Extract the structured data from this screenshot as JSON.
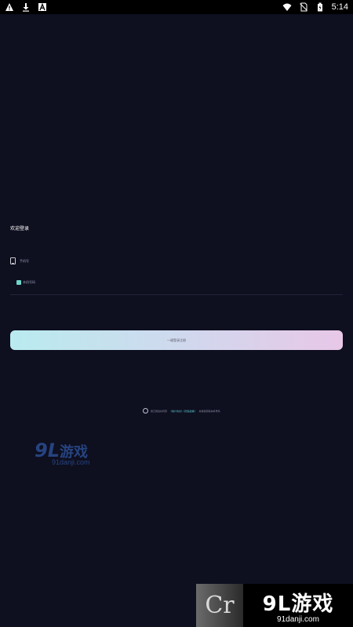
{
  "status_bar": {
    "icons_left": [
      "warning-icon",
      "download-icon",
      "app-icon"
    ],
    "icons_right": [
      "wifi-icon",
      "no-sim-icon",
      "battery-icon"
    ],
    "time": "5:14"
  },
  "login": {
    "welcome_title": "欢迎登录",
    "phone_label": "手机号",
    "one_click_label": "本机号码",
    "button_label": "一键登录注册",
    "agreement_prefix": "我已阅读并同意",
    "agreement_link": "《用户协议》《隐私政策》",
    "agreement_suffix": "并授权获取本机号码"
  },
  "watermark": {
    "left_logo": "9L",
    "left_game": "游戏",
    "left_domain": "91danji.com",
    "bar_letter": "Cr",
    "bar_logo": "9L游戏",
    "bar_domain": "91danji.com"
  },
  "colors": {
    "background": "#0e0f1f",
    "button_gradient_start": "#b9ebef",
    "button_gradient_end": "#e8c7e7",
    "link": "#5fd0d8"
  }
}
